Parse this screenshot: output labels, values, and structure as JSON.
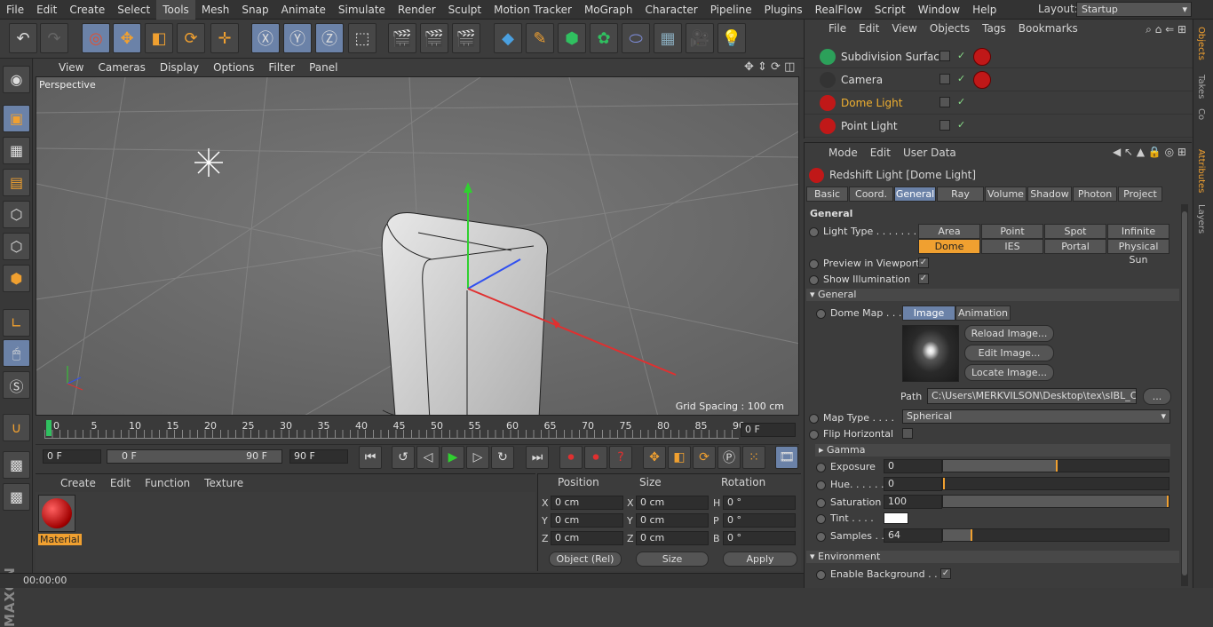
{
  "menu": [
    "File",
    "Edit",
    "Create",
    "Select",
    "Tools",
    "Mesh",
    "Snap",
    "Animate",
    "Simulate",
    "Render",
    "Sculpt",
    "Motion Tracker",
    "MoGraph",
    "Character",
    "Pipeline",
    "Plugins",
    "RealFlow",
    "Script",
    "Window",
    "Help"
  ],
  "layout": {
    "label": "Layout:",
    "value": "Startup"
  },
  "viewport": {
    "menu": [
      "View",
      "Cameras",
      "Display",
      "Options",
      "Filter",
      "Panel"
    ],
    "label": "Perspective",
    "grid": "Grid Spacing : 100 cm"
  },
  "timeline": {
    "ticks": [
      "0",
      "5",
      "10",
      "15",
      "20",
      "25",
      "30",
      "35",
      "40",
      "45",
      "50",
      "55",
      "60",
      "65",
      "70",
      "75",
      "80",
      "85",
      "90"
    ],
    "frame": "0 F",
    "start": "0 F",
    "range_start": "0 F",
    "range_end": "90 F",
    "end": "90 F"
  },
  "material": {
    "menu": [
      "Create",
      "Edit",
      "Function",
      "Texture"
    ],
    "name": "Material"
  },
  "coords": {
    "headers": [
      "Position",
      "Size",
      "Rotation"
    ],
    "rows": [
      {
        "a": "X",
        "p": "0 cm",
        "b": "X",
        "s": "0 cm",
        "c": "H",
        "r": "0 °"
      },
      {
        "a": "Y",
        "p": "0 cm",
        "b": "Y",
        "s": "0 cm",
        "c": "P",
        "r": "0 °"
      },
      {
        "a": "Z",
        "p": "0 cm",
        "b": "Z",
        "s": "0 cm",
        "c": "B",
        "r": "0 °"
      }
    ],
    "mode": "Object (Rel)",
    "size": "Size",
    "apply": "Apply"
  },
  "status": "00:00:00",
  "objects": {
    "menu": [
      "File",
      "Edit",
      "View",
      "Objects",
      "Tags",
      "Bookmarks"
    ],
    "items": [
      {
        "name": "Subdivision Surface",
        "color": "#2ca05a"
      },
      {
        "name": "Camera",
        "color": "#333333"
      },
      {
        "name": "Dome Light",
        "color": "#c01818"
      },
      {
        "name": "Point Light",
        "color": "#c01818"
      }
    ]
  },
  "sidetabs": [
    "Objects",
    "Takes",
    "Co",
    "Attributes",
    "Layers"
  ],
  "attributes": {
    "menu": [
      "Mode",
      "Edit",
      "User Data"
    ],
    "title": "Redshift Light [Dome Light]",
    "tabs": [
      "Basic",
      "Coord.",
      "General",
      "Ray",
      "Volume",
      "Shadow",
      "Photon",
      "Project"
    ],
    "section_general": "General",
    "light_type_label": "Light Type . . . . . . . . .",
    "light_types": [
      "Area",
      "Point",
      "Spot",
      "Infinite",
      "Dome",
      "IES",
      "Portal",
      "Physical Sun"
    ],
    "preview": "Preview in Viewport",
    "show_illum": "Show Illumination",
    "sub_general": "General",
    "dome_map": "Dome Map . . .",
    "image_tab": "Image",
    "anim_tab": "Animation",
    "reload": "Reload Image...",
    "edit": "Edit Image...",
    "locate": "Locate Image...",
    "path_label": "Path",
    "path": "C:\\Users\\MERKVILSON\\Desktop\\tex\\sIBL_Col",
    "path_btn": "...",
    "map_type_label": "Map Type . . . .",
    "map_type": "Spherical",
    "flip": "Flip Horizontal",
    "gamma": "Gamma",
    "exposure_label": "Exposure",
    "exposure": "0",
    "hue_label": "Hue. . . . . .",
    "hue": "0",
    "sat_label": "Saturation",
    "sat": "100",
    "tint_label": "Tint . . . .",
    "samples_label": "Samples . .",
    "samples": "64",
    "env": "Environment",
    "enable_bg": "Enable Background . . ."
  }
}
